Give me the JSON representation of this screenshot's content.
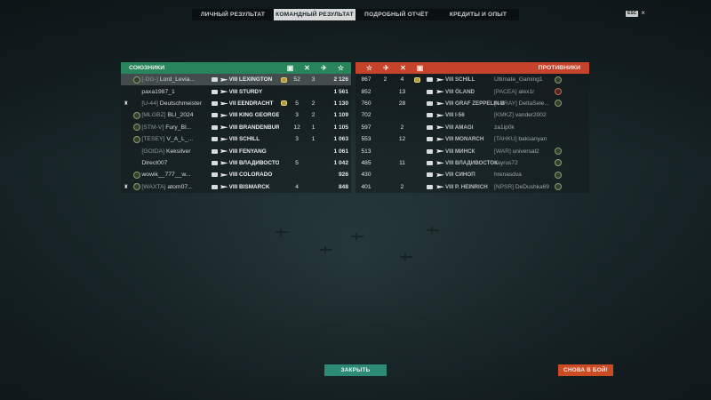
{
  "tabs": [
    "ЛИЧНЫЙ РЕЗУЛЬТАТ",
    "КОМАНДНЫЙ РЕЗУЛЬТАТ",
    "ПОДРОБНЫЙ ОТЧЁТ",
    "КРЕДИТЫ И ОПЫТ"
  ],
  "active_tab": "КОМАНДНЫЙ РЕЗУЛЬТАТ",
  "esc_label": "ESC",
  "close_glyph": "×",
  "allies": {
    "title": "СОЮЗНИКИ",
    "header_icons": [
      "medal-icon",
      "frag-icon",
      "plane-icon",
      "star-icon"
    ],
    "rows": [
      {
        "clan": "[-DG-]",
        "name": "Lord_Levia...",
        "tier": "VIII",
        "ship": "LEXINGTON",
        "medal": true,
        "kills": "52",
        "planes": "3",
        "xp": "2 126",
        "highlight": true,
        "division": "",
        "avatar": true
      },
      {
        "clan": "",
        "name": "paxa1987_1",
        "tier": "VIII",
        "ship": "STURDY",
        "medal": false,
        "kills": "",
        "planes": "",
        "xp": "1 561",
        "highlight": false,
        "division": "",
        "avatar": false
      },
      {
        "clan": "[U-44]",
        "name": "Deutschmeister",
        "tier": "VII",
        "ship": "EENDRACHT",
        "medal": true,
        "kills": "5",
        "planes": "2",
        "xp": "1 130",
        "highlight": false,
        "division": "♜",
        "avatar": false
      },
      {
        "clan": "[MLGBZ]",
        "name": "BLI_2024",
        "tier": "VIII",
        "ship": "KING GEORGE V",
        "medal": false,
        "kills": "3",
        "planes": "2",
        "xp": "1 109",
        "highlight": false,
        "division": "",
        "avatar": true
      },
      {
        "clan": "[STM-V]",
        "name": "Fury_Bl...",
        "tier": "VIII",
        "ship": "BRANDENBURG",
        "medal": false,
        "kills": "12",
        "planes": "1",
        "xp": "1 105",
        "highlight": false,
        "division": "",
        "avatar": true
      },
      {
        "clan": "[TESEY]",
        "name": "V_A_L_...",
        "tier": "VIII",
        "ship": "SCHILL",
        "medal": false,
        "kills": "3",
        "planes": "1",
        "xp": "1 063",
        "highlight": false,
        "division": "",
        "avatar": true
      },
      {
        "clan": "[GOIDA]",
        "name": "Keksilver",
        "tier": "VIII",
        "ship": "FENYANG",
        "medal": false,
        "kills": "",
        "planes": "",
        "xp": "1 061",
        "highlight": false,
        "division": "",
        "avatar": false
      },
      {
        "clan": "",
        "name": "Direct007",
        "tier": "VIII",
        "ship": "ВЛАДИВОСТОК",
        "medal": false,
        "kills": "5",
        "planes": "",
        "xp": "1 042",
        "highlight": false,
        "division": "",
        "avatar": false
      },
      {
        "clan": "",
        "name": "wowik__777__w...",
        "tier": "VIII",
        "ship": "COLORADO",
        "medal": false,
        "kills": "",
        "planes": "",
        "xp": "926",
        "highlight": false,
        "division": "",
        "avatar": true
      },
      {
        "clan": "[WAXTA]",
        "name": "atom07...",
        "tier": "VIII",
        "ship": "BISMARCK",
        "medal": false,
        "kills": "4",
        "planes": "",
        "xp": "848",
        "highlight": false,
        "division": "♜",
        "avatar": true
      }
    ]
  },
  "enemies": {
    "title": "ПРОТИВНИКИ",
    "header_icons": [
      "star-icon",
      "plane-icon",
      "frag-icon",
      "medal-icon"
    ],
    "rows": [
      {
        "xp": "867",
        "planes": "2",
        "kills": "4",
        "medal": true,
        "tier": "VIII",
        "ship": "SCHILL",
        "clan": "",
        "name": "Ultimate_Gaming1",
        "avatar": true,
        "red": false
      },
      {
        "xp": "852",
        "planes": "",
        "kills": "13",
        "medal": false,
        "tier": "VIII",
        "ship": "ÖLAND",
        "clan": "[PACEA]",
        "name": "alex1r",
        "avatar": true,
        "red": true
      },
      {
        "xp": "760",
        "planes": "",
        "kills": "28",
        "medal": false,
        "tier": "VIII",
        "ship": "GRAF ZEPPELIN B",
        "clan": "[ARRAY]",
        "name": "DeltaSele...",
        "avatar": true,
        "red": false
      },
      {
        "xp": "702",
        "planes": "",
        "kills": "",
        "medal": false,
        "tier": "VIII",
        "ship": "I-56",
        "clan": "[KMKZ]",
        "name": "vander2002",
        "avatar": false,
        "red": false
      },
      {
        "xp": "597",
        "planes": "",
        "kills": "2",
        "medal": false,
        "tier": "VIII",
        "ship": "AMAGI",
        "clan": "",
        "name": "za1ip0k",
        "avatar": false,
        "red": false
      },
      {
        "xp": "553",
        "planes": "",
        "kills": "12",
        "medal": false,
        "tier": "VIII",
        "ship": "MONARCH",
        "clan": "[TAHKU]",
        "name": "baksanyan",
        "avatar": false,
        "red": false
      },
      {
        "xp": "513",
        "planes": "",
        "kills": "",
        "medal": false,
        "tier": "VIII",
        "ship": "МИНСК",
        "clan": "[WAR]",
        "name": "universal2",
        "avatar": true,
        "red": false
      },
      {
        "xp": "485",
        "planes": "",
        "kills": "11",
        "medal": false,
        "tier": "VIII",
        "ship": "ВЛАДИВОСТОК",
        "clan": "",
        "name": "sayrus72",
        "avatar": true,
        "red": false
      },
      {
        "xp": "430",
        "planes": "",
        "kills": "",
        "medal": false,
        "tier": "VIII",
        "ship": "СИНОП",
        "clan": "",
        "name": "hrenasdva",
        "avatar": true,
        "red": false
      },
      {
        "xp": "401",
        "planes": "",
        "kills": "2",
        "medal": false,
        "tier": "VIII",
        "ship": "P. HEINRICH",
        "clan": "[NPSR]",
        "name": "DeDushka69",
        "avatar": true,
        "red": false
      }
    ]
  },
  "buttons": {
    "close": "ЗАКРЫТЬ",
    "battle": "СНОВА В БОЙ!"
  },
  "colors": {
    "ally": "#28845a",
    "enemy": "#c4432a",
    "close_button": "#2d8a74",
    "battle_button": "#cd4b22"
  }
}
